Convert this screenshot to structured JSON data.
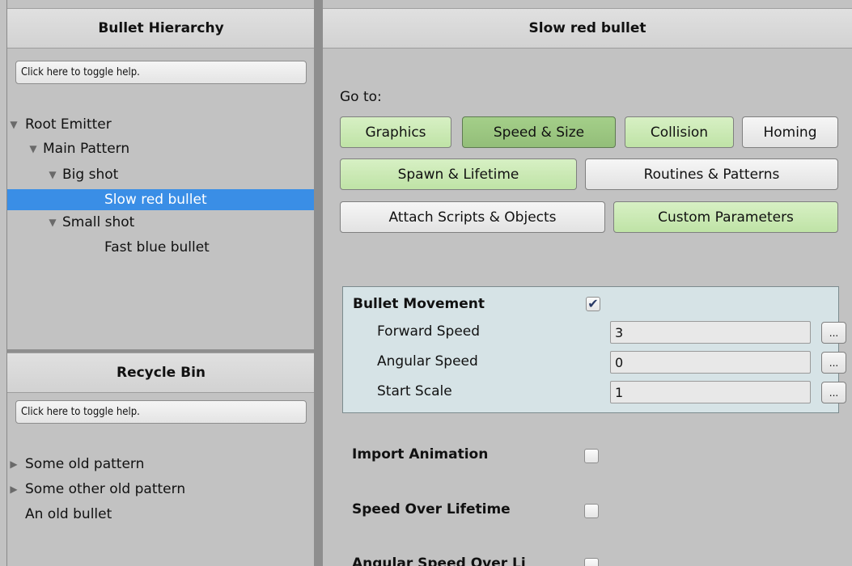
{
  "hierarchy": {
    "title": "Bullet Hierarchy",
    "help": "Click here to toggle help.",
    "items": [
      {
        "label": "Root Emitter",
        "expanded": true
      },
      {
        "label": "Main Pattern",
        "expanded": true
      },
      {
        "label": "Big shot",
        "expanded": true
      },
      {
        "label": "Slow red bullet",
        "selected": true
      },
      {
        "label": "Small shot",
        "expanded": true
      },
      {
        "label": "Fast blue bullet"
      }
    ]
  },
  "recycle": {
    "title": "Recycle Bin",
    "help": "Click here to toggle help.",
    "items": [
      {
        "label": "Some old pattern",
        "expanded": false
      },
      {
        "label": "Some other old pattern",
        "expanded": false
      },
      {
        "label": "An old bullet"
      }
    ]
  },
  "inspector": {
    "title": "Slow red bullet",
    "goto_label": "Go to:",
    "tabs": {
      "graphics": "Graphics",
      "speed_size": "Speed & Size",
      "collision": "Collision",
      "homing": "Homing",
      "spawn_lifetime": "Spawn & Lifetime",
      "routines": "Routines & Patterns",
      "attach": "Attach Scripts & Objects",
      "custom": "Custom Parameters"
    },
    "movement": {
      "label": "Bullet Movement",
      "enabled": true,
      "check_glyph": "✔",
      "forward_speed_label": "Forward Speed",
      "forward_speed": "3",
      "angular_speed_label": "Angular Speed",
      "angular_speed": "0",
      "start_scale_label": "Start Scale",
      "start_scale": "1",
      "dots": "..."
    },
    "import_animation": {
      "label": "Import Animation",
      "enabled": false
    },
    "speed_over_lifetime": {
      "label": "Speed Over Lifetime",
      "enabled": false
    },
    "angular_speed_over_lifetime": {
      "label": "Angular Speed Over Li",
      "enabled": false
    }
  },
  "colors": {
    "selected": "#3a8ee6",
    "tab_green": "#bfe3a6",
    "tab_green_active": "#93be79",
    "group_box": "#d6e3e6"
  },
  "icons": {
    "expanded": "▼",
    "collapsed": "▶"
  }
}
